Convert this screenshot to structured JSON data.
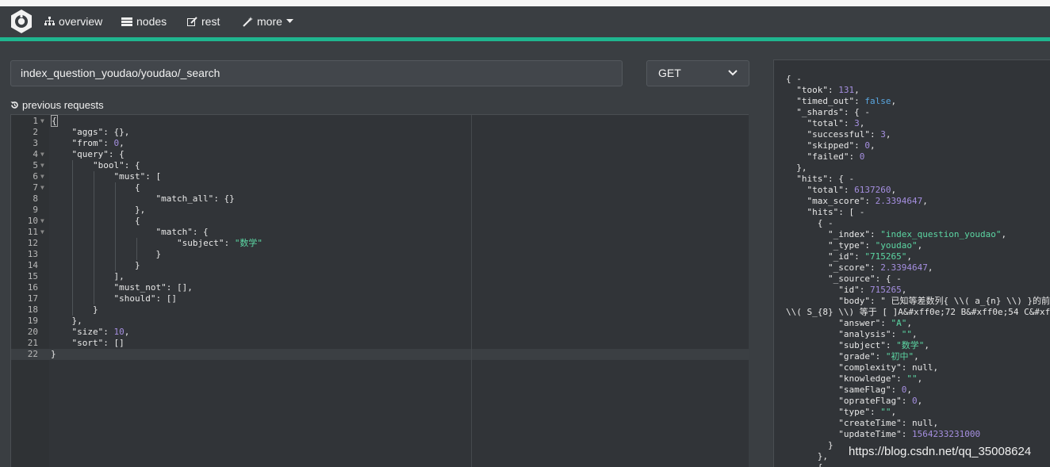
{
  "nav": {
    "overview": "overview",
    "nodes": "nodes",
    "rest": "rest",
    "more": "more"
  },
  "request": {
    "url": "index_question_youdao/youdao/_search",
    "method": "GET",
    "previous_label": "previous requests"
  },
  "editor_lines": [
    {
      "n": "1",
      "text": "{"
    },
    {
      "n": "2",
      "text": "    \"aggs\": {},"
    },
    {
      "n": "3",
      "text": "    \"from\": 0,"
    },
    {
      "n": "4",
      "text": "    \"query\": {"
    },
    {
      "n": "5",
      "text": "        \"bool\": {"
    },
    {
      "n": "6",
      "text": "            \"must\": ["
    },
    {
      "n": "7",
      "text": "                {"
    },
    {
      "n": "8",
      "text": "                    \"match_all\": {}"
    },
    {
      "n": "9",
      "text": "                },"
    },
    {
      "n": "10",
      "text": "                {"
    },
    {
      "n": "11",
      "text": "                    \"match\": {"
    },
    {
      "n": "12",
      "text": "                        \"subject\": \"数学\""
    },
    {
      "n": "13",
      "text": "                    }"
    },
    {
      "n": "14",
      "text": "                }"
    },
    {
      "n": "15",
      "text": "            ],"
    },
    {
      "n": "16",
      "text": "            \"must_not\": [],"
    },
    {
      "n": "17",
      "text": "            \"should\": []"
    },
    {
      "n": "18",
      "text": "        }"
    },
    {
      "n": "19",
      "text": "    },"
    },
    {
      "n": "20",
      "text": "    \"size\": 10,"
    },
    {
      "n": "21",
      "text": "    \"sort\": []"
    },
    {
      "n": "22",
      "text": "}"
    }
  ],
  "response_lines": [
    "{ -",
    "  \"took\": 131,",
    "  \"timed_out\": false,",
    "  \"_shards\": { -",
    "    \"total\": 3,",
    "    \"successful\": 3,",
    "    \"skipped\": 0,",
    "    \"failed\": 0",
    "  },",
    "  \"hits\": { -",
    "    \"total\": 6137260,",
    "    \"max_score\": 2.3394647,",
    "    \"hits\": [ -",
    "      { -",
    "        \"_index\": \"index_question_youdao\",",
    "        \"_type\": \"youdao\",",
    "        \"_id\": \"715265\",",
    "        \"_score\": 2.3394647,",
    "        \"_source\": { -",
    "          \"id\": 715265,",
    "          \"body\": \" 已知等差数列{ \\\\( a_{n} \\\\) }的前",
    "\\\\( S_{8} \\\\) 等于 [ ]A&#xff0e;72 B&#xff0e;54 C&#xf",
    "          \"answer\": \"A\",",
    "          \"analysis\": \"\",",
    "          \"subject\": \"数学\",",
    "          \"grade\": \"初中\",",
    "          \"complexity\": null,",
    "          \"knowledge\": \"\",",
    "          \"sameFlag\": 0,",
    "          \"oprateFlag\": 0,",
    "          \"type\": \"\",",
    "          \"createTime\": null,",
    "          \"updateTime\": 1564233231000",
    "        }",
    "      },",
    "      {"
  ],
  "watermark": "https://blog.csdn.net/qq_35008624"
}
